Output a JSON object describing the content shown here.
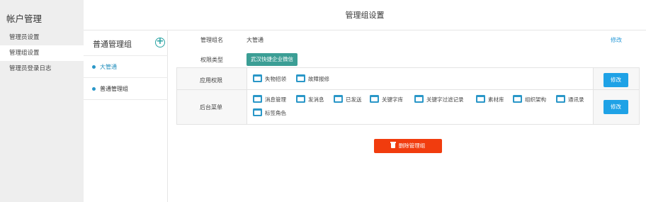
{
  "sidebar": {
    "title": "帐户管理",
    "items": [
      {
        "label": "管理员设置"
      },
      {
        "label": "管理组设置"
      },
      {
        "label": "管理员登录日志"
      }
    ]
  },
  "header": {
    "title": "管理组设置"
  },
  "groups": {
    "title": "普通管理组",
    "items": [
      {
        "label": "大管通"
      },
      {
        "label": "普通管理组"
      }
    ]
  },
  "detail": {
    "name_label": "管理组名",
    "name_value": "大管通",
    "name_edit": "修改",
    "perm_type_label": "权限类型",
    "perm_type_value": "武汉快捷企业微信",
    "app_perm_label": "应用权限",
    "app_perms": [
      "失物招领",
      "故障报修"
    ],
    "app_edit": "修改",
    "menu_label": "后台菜单",
    "menus": [
      "消息管理",
      "发消息",
      "已发送",
      "关键字库",
      "关键字过滤记录",
      "素材库",
      "组织架构",
      "通讯录",
      "标签角色"
    ],
    "menu_edit": "修改",
    "delete_label": "删除管理组"
  },
  "icons": {
    "accent": "#2a97c8",
    "delete_color": "#f13c0e",
    "tag_color": "#3b9e95"
  }
}
